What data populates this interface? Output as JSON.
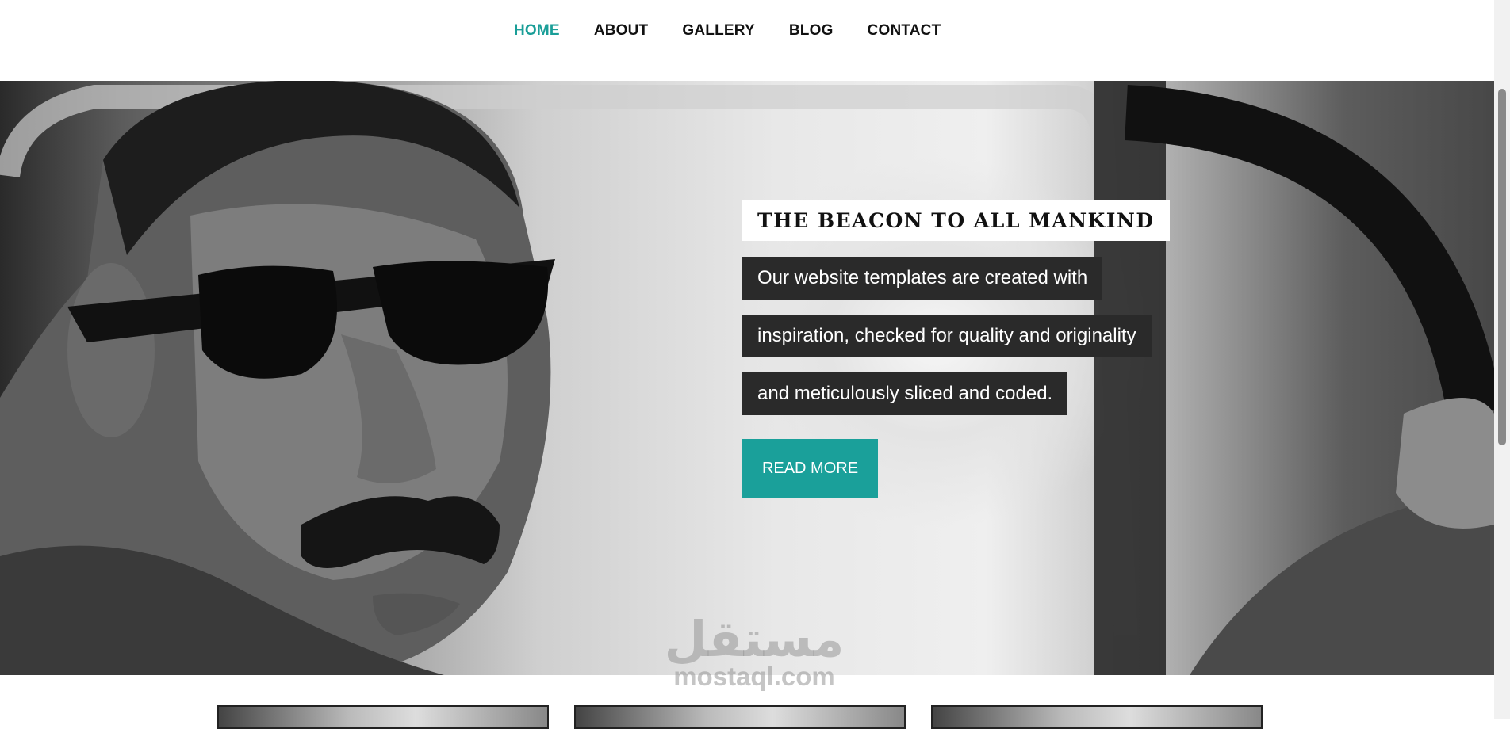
{
  "nav": {
    "items": [
      {
        "label": "HOME",
        "active": true
      },
      {
        "label": "ABOUT",
        "active": false
      },
      {
        "label": "GALLERY",
        "active": false
      },
      {
        "label": "BLOG",
        "active": false
      },
      {
        "label": "CONTACT",
        "active": false
      }
    ],
    "active_color": "#1a9e98"
  },
  "hero": {
    "title": "THE BEACON TO ALL MANKIND",
    "description_lines": [
      "Our website templates are created with",
      "inspiration, checked for quality and originality",
      "and meticulously sliced and coded."
    ],
    "button_label": "READ MORE",
    "button_color": "#1aa09a",
    "image": "black-and-white-man-with-sunglasses-in-car"
  },
  "watermark": {
    "arabic": "مستقل",
    "latin": "mostaql.com"
  },
  "icons": {
    "scrollbar": "vertical-scrollbar"
  }
}
